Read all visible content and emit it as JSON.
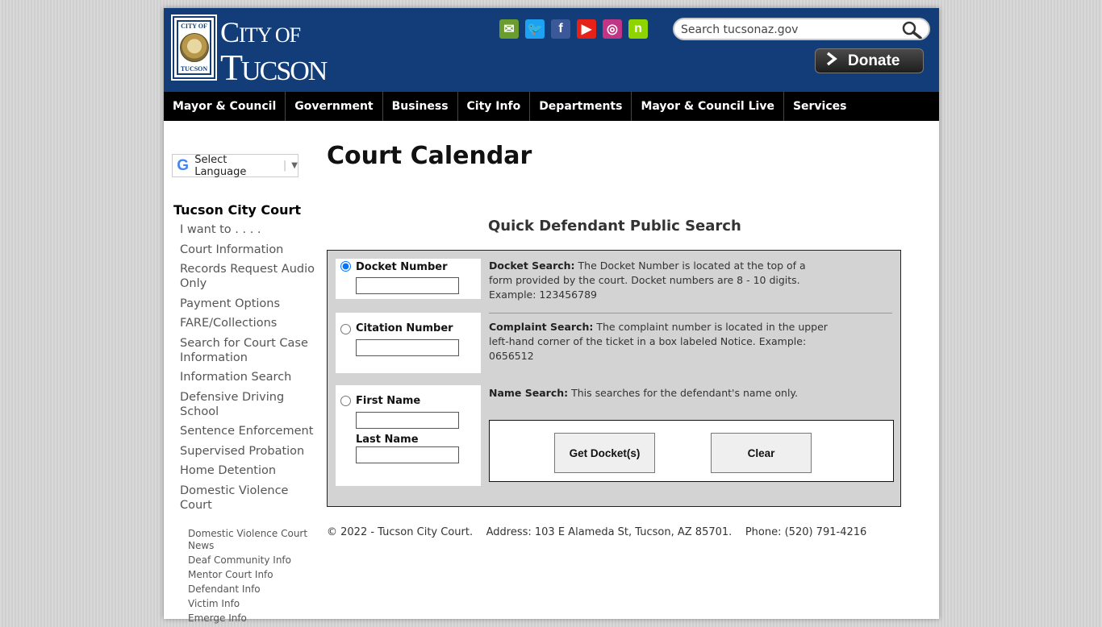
{
  "header": {
    "logo": {
      "seal_top": "CITY OF",
      "seal_bottom": "TUCSON",
      "city_first": "C",
      "city_rest": "ITY OF",
      "tucson_first": "T",
      "tucson_rest": "UCSON"
    },
    "social": [
      {
        "name": "email-icon",
        "glyph": "✉",
        "color": "#6a9c2e"
      },
      {
        "name": "twitter-icon",
        "glyph": "🐦",
        "color": "#1da1f2"
      },
      {
        "name": "facebook-icon",
        "glyph": "f",
        "color": "#3b5998"
      },
      {
        "name": "youtube-icon",
        "glyph": "▶",
        "color": "#e62117"
      },
      {
        "name": "instagram-icon",
        "glyph": "◎",
        "color": "#c13584"
      },
      {
        "name": "nextdoor-icon",
        "glyph": "n",
        "color": "#8ed500"
      }
    ],
    "search": {
      "placeholder": "Search tucsonaz.gov"
    },
    "donate_label": "Donate"
  },
  "nav": {
    "items": [
      "Mayor & Council",
      "Government",
      "Business",
      "City Info",
      "Departments",
      "Mayor & Council Live",
      "Services"
    ]
  },
  "sidebar": {
    "language_label": "Select Language",
    "title": "Tucson City Court",
    "links": [
      "I want to . . . .",
      "Court Information",
      "Records Request Audio Only",
      "Payment Options",
      "FARE/Collections",
      "Search for Court Case Information",
      "Information Search",
      "Defensive Driving School",
      "Sentence Enforcement",
      "Supervised Probation",
      "Home Detention",
      "Domestic Violence Court"
    ],
    "sublinks": [
      "Domestic Violence Court News",
      "Deaf Community Info",
      "Mentor Court Info",
      "Defendant Info",
      "Victim Info",
      "Emerge Info"
    ]
  },
  "main": {
    "page_title": "Court Calendar",
    "search_title": "Quick Defendant Public Search",
    "docket": {
      "label": "Docket Number",
      "value": "",
      "desc_title": "Docket Search:",
      "desc": " The Docket Number is located at the top of a form provided by the court. Docket numbers are 8 - 10 digits. Example: 123456789"
    },
    "citation": {
      "label": "Citation Number",
      "value": "",
      "desc_title": "Complaint Search:",
      "desc": " The complaint number is located in the upper left-hand corner of the ticket in a box labeled Notice. Example: 0656512"
    },
    "name": {
      "first_label": "First Name",
      "last_label": "Last Name",
      "first_value": "",
      "last_value": "",
      "desc_title": "Name Search:",
      "desc": " This searches for the defendant's name only."
    },
    "get_docket_label": "Get Docket(s)",
    "clear_label": "Clear"
  },
  "footer": {
    "text": "© 2022 - Tucson City Court.    Address: 103 E Alameda St, Tucson, AZ 85701.    Phone: (520) 791-4216"
  }
}
